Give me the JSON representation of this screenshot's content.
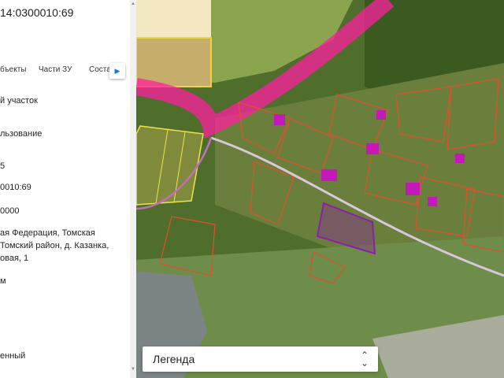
{
  "panel": {
    "cadastral_title": "14:0300010:69",
    "tabs": [
      {
        "label": "бъекты"
      },
      {
        "label": "Части ЗУ"
      },
      {
        "label": "Соста"
      }
    ],
    "tab_scroll_icon": "chevron-right-icon",
    "fields": [
      {
        "value": "й участок"
      },
      {
        "value": "льзование"
      },
      {
        "value": "5"
      },
      {
        "value": "0010:69"
      },
      {
        "value": "0000"
      },
      {
        "value": "ая Федерация, Томская"
      },
      {
        "value": "Томский район, д. Казанка,"
      },
      {
        "value": "овая, 1"
      },
      {
        "value": "м"
      },
      {
        "value": "енный"
      }
    ]
  },
  "map": {
    "parcel_outline_color": "#e0502c",
    "highlight_color": "#d800d8",
    "selected_parcel_color": "#8c1ea8",
    "road_zone_color": "#ff1fa0"
  },
  "legend": {
    "label": "Легенда",
    "toggle_icon": "chevron-up-down-icon"
  }
}
